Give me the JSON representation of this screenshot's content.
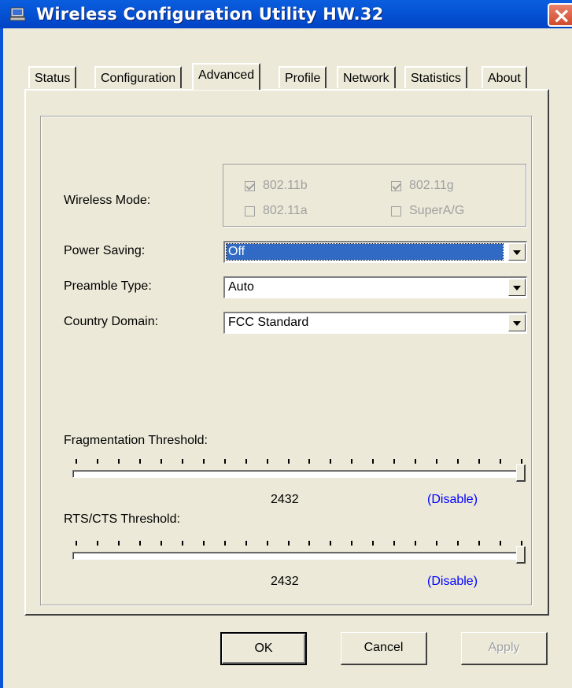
{
  "window": {
    "title": "Wireless Configuration Utility HW.32",
    "titlebar_color": "#0054e3",
    "close_color": "#d04a2e"
  },
  "tabs": [
    {
      "label": "Status",
      "active": false
    },
    {
      "label": "Configuration",
      "active": false
    },
    {
      "label": "Advanced",
      "active": true
    },
    {
      "label": "Profile",
      "active": false
    },
    {
      "label": "Network",
      "active": false
    },
    {
      "label": "Statistics",
      "active": false
    },
    {
      "label": "About",
      "active": false
    }
  ],
  "advanced": {
    "wireless_mode": {
      "label": "Wireless Mode:",
      "options": [
        {
          "label": "802.11b",
          "checked": true,
          "enabled": false
        },
        {
          "label": "802.11g",
          "checked": true,
          "enabled": false
        },
        {
          "label": "802.11a",
          "checked": false,
          "enabled": false
        },
        {
          "label": "SuperA/G",
          "checked": false,
          "enabled": false
        }
      ]
    },
    "power_saving": {
      "label": "Power Saving:",
      "value": "Off"
    },
    "preamble_type": {
      "label": "Preamble Type:",
      "value": "Auto"
    },
    "country_domain": {
      "label": "Country Domain:",
      "value": "FCC Standard"
    },
    "fragmentation": {
      "label": "Fragmentation Threshold:",
      "value": "2432",
      "status": "(Disable)",
      "level": 1.0
    },
    "rts_cts": {
      "label": "RTS/CTS Threshold:",
      "value": "2432",
      "status": "(Disable)",
      "level": 1.0
    }
  },
  "buttons": {
    "ok": "OK",
    "cancel": "Cancel",
    "apply": "Apply"
  }
}
